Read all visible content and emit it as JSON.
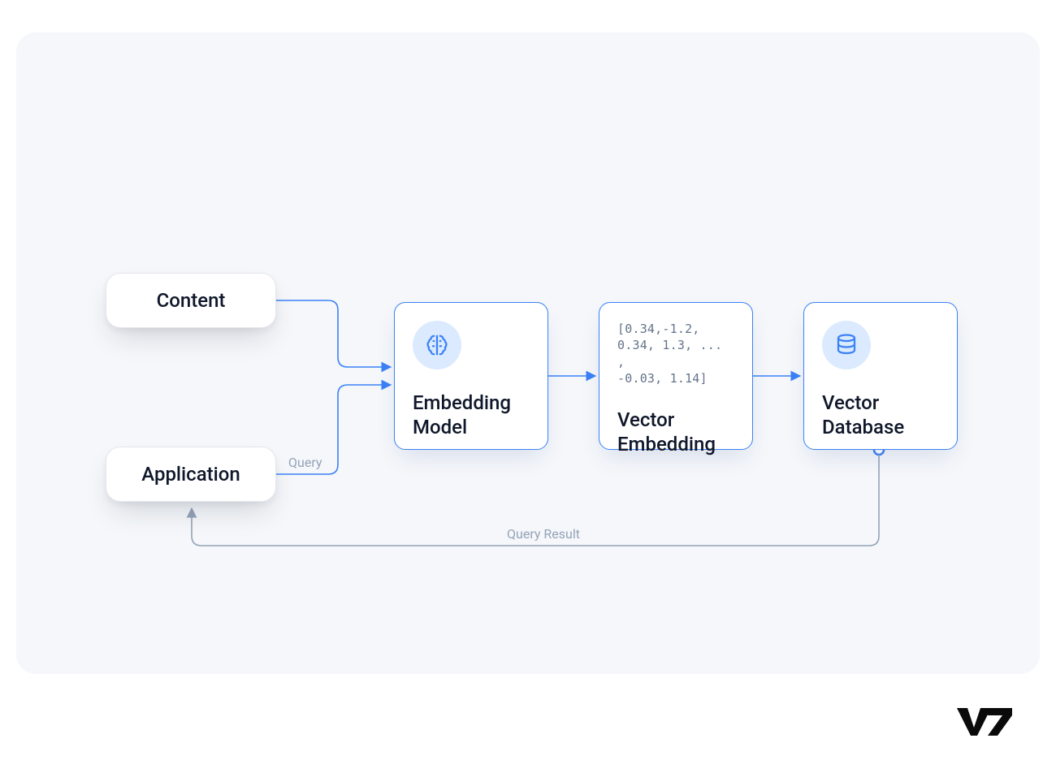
{
  "nodes": {
    "content": {
      "label": "Content"
    },
    "application": {
      "label": "Application"
    },
    "embedding_model": {
      "title_line1": "Embedding",
      "title_line2": "Model",
      "icon": "brain-icon"
    },
    "vector_embedding": {
      "title_line1": "Vector",
      "title_line2": "Embedding",
      "sample_line1": "[0.34,-1.2,",
      "sample_line2": "0.34, 1.3, ... ,",
      "sample_line3": "-0.03, 1.14]"
    },
    "vector_database": {
      "title_line1": "Vector",
      "title_line2": "Database",
      "icon": "database-icon"
    }
  },
  "edges": {
    "query_label": "Query",
    "result_label": "Query Result"
  },
  "brand": {
    "logo_text": "V7"
  },
  "colors": {
    "node_border_blue": "#3b82f6",
    "canvas_bg": "#f5f7fa",
    "text": "#0f172a",
    "muted": "#94a3b8",
    "return_arrow": "#94a3b8"
  }
}
